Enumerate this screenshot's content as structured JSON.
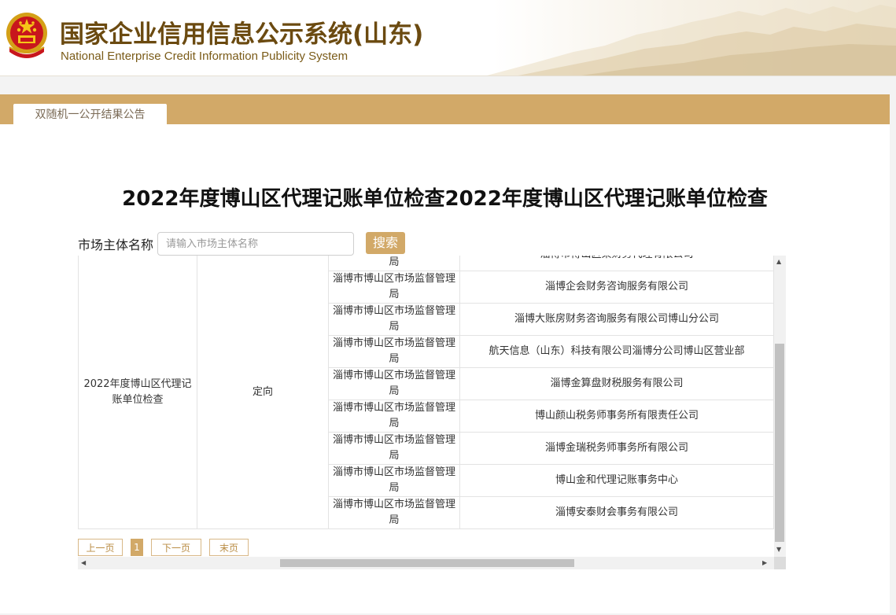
{
  "header": {
    "title_cn": "国家企业信用信息公示系统(山东)",
    "title_en": "National Enterprise Credit Information Publicity System"
  },
  "tab": {
    "label": "双随机一公开结果公告"
  },
  "page": {
    "title": "2022年度博山区代理记账单位检查2022年度博山区代理记账单位检查"
  },
  "search": {
    "label": "市场主体名称",
    "placeholder": "请输入市场主体名称",
    "button": "搜索"
  },
  "table": {
    "task_name": "2022年度博山区代理记账单位检查",
    "task_type": "定向",
    "rows": [
      {
        "dept": "淄博市博山区市场监督管理局",
        "company": "淄博市博山区某财务代理有限公司"
      },
      {
        "dept": "淄博市博山区市场监督管理局",
        "company": "淄博企会财务咨询服务有限公司"
      },
      {
        "dept": "淄博市博山区市场监督管理局",
        "company": "淄博大账房财务咨询服务有限公司博山分公司"
      },
      {
        "dept": "淄博市博山区市场监督管理局",
        "company": "航天信息（山东）科技有限公司淄博分公司博山区营业部"
      },
      {
        "dept": "淄博市博山区市场监督管理局",
        "company": "淄博金算盘财税服务有限公司"
      },
      {
        "dept": "淄博市博山区市场监督管理局",
        "company": "博山颜山税务师事务所有限责任公司"
      },
      {
        "dept": "淄博市博山区市场监督管理局",
        "company": "淄博金瑞税务师事务所有限公司"
      },
      {
        "dept": "淄博市博山区市场监督管理局",
        "company": "博山金和代理记账事务中心"
      },
      {
        "dept": "淄博市博山区市场监督管理局",
        "company": "淄博安泰财会事务有限公司"
      }
    ]
  },
  "pager": {
    "prev": "上一页",
    "current": "1",
    "next": "下一页",
    "last": "末页"
  },
  "colors": {
    "brand_gold": "#d2a968",
    "title_brown": "#6b4a10"
  }
}
